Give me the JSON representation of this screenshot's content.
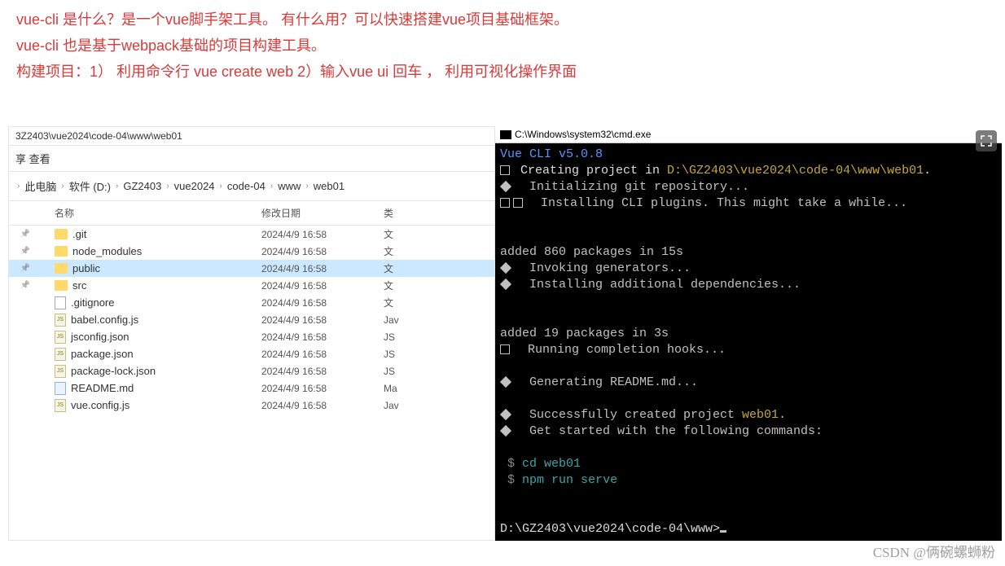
{
  "header": {
    "line1": "vue-cli   是什么？是一个vue脚手架工具。   有什么用？可以快速搭建vue项目基础框架。",
    "line2": "vue-cli 也是基于webpack基础的项目构建工具。",
    "line3": "构建项目：1）  利用命令行 vue create web      2）输入vue ui 回车 ， 利用可视化操作界面"
  },
  "explorer": {
    "title": "3Z2403\\vue2024\\code-04\\www\\web01",
    "toolbar": {
      "view": "查看"
    },
    "breadcrumb": [
      "此电脑",
      "软件 (D:)",
      "GZ2403",
      "vue2024",
      "code-04",
      "www",
      "web01"
    ],
    "columns": {
      "name": "名称",
      "date": "修改日期",
      "type": "类"
    },
    "files": [
      {
        "pin": true,
        "icon": "folder",
        "name": ".git",
        "date": "2024/4/9 16:58",
        "type": "文"
      },
      {
        "pin": true,
        "icon": "folder",
        "name": "node_modules",
        "date": "2024/4/9 16:58",
        "type": "文"
      },
      {
        "pin": true,
        "icon": "folder",
        "name": "public",
        "date": "2024/4/9 16:58",
        "type": "文",
        "sel": true
      },
      {
        "pin": true,
        "icon": "folder",
        "name": "src",
        "date": "2024/4/9 16:58",
        "type": "文"
      },
      {
        "pin": false,
        "icon": "txt",
        "name": ".gitignore",
        "date": "2024/4/9 16:58",
        "type": "文"
      },
      {
        "pin": false,
        "icon": "js",
        "name": "babel.config.js",
        "date": "2024/4/9 16:58",
        "type": "Jav"
      },
      {
        "pin": false,
        "icon": "js",
        "name": "jsconfig.json",
        "date": "2024/4/9 16:58",
        "type": "JS"
      },
      {
        "pin": false,
        "icon": "js",
        "name": "package.json",
        "date": "2024/4/9 16:58",
        "type": "JS"
      },
      {
        "pin": false,
        "icon": "js",
        "name": "package-lock.json",
        "date": "2024/4/9 16:58",
        "type": "JS"
      },
      {
        "pin": false,
        "icon": "md",
        "name": "README.md",
        "date": "2024/4/9 16:58",
        "type": "Ma"
      },
      {
        "pin": false,
        "icon": "js",
        "name": "vue.config.js",
        "date": "2024/4/9 16:58",
        "type": "Jav"
      }
    ]
  },
  "terminal": {
    "title": "C:\\Windows\\system32\\cmd.exe",
    "vue_cli": "Vue CLI v5.0.8",
    "creating_prefix": "✨  Creating project in ",
    "creating_path": "D:\\GZ2403\\vue2024\\code-04\\www\\web01",
    "init_git": "  Initializing git repository...",
    "install_cli": "  Installing CLI plugins. This might take a while...",
    "added1": "added 860 packages in 15s",
    "invoking": "  Invoking generators...",
    "install_add": "  Installing additional dependencies...",
    "added2": "added 19 packages in 3s",
    "running": "  Running completion hooks...",
    "readme": "  Generating README.md...",
    "success_prefix": "  Successfully created project ",
    "success_proj": "web01",
    "get_started": "  Get started with the following commands:",
    "cmd1": "cd web01",
    "cmd2": "npm run serve",
    "prompt": "D:\\GZ2403\\vue2024\\code-04\\www>"
  },
  "watermark": "CSDN @俩碗螺蛳粉"
}
